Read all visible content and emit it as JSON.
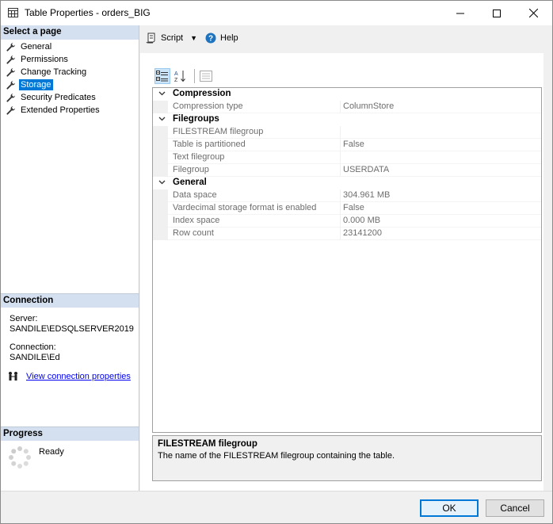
{
  "window": {
    "title": "Table Properties - orders_BIG"
  },
  "left": {
    "select_page_header": "Select a page",
    "pages": [
      {
        "label": "General",
        "selected": false
      },
      {
        "label": "Permissions",
        "selected": false
      },
      {
        "label": "Change Tracking",
        "selected": false
      },
      {
        "label": "Storage",
        "selected": true
      },
      {
        "label": "Security Predicates",
        "selected": false
      },
      {
        "label": "Extended Properties",
        "selected": false
      }
    ],
    "connection_header": "Connection",
    "server_label": "Server:",
    "server_value": "SANDILE\\EDSQLSERVER2019",
    "connection_label": "Connection:",
    "connection_value": "SANDILE\\Ed",
    "view_link": "View connection properties",
    "progress_header": "Progress",
    "progress_status": "Ready"
  },
  "toolbar": {
    "script_label": "Script",
    "help_label": "Help"
  },
  "grid": {
    "categories": [
      {
        "name": "Compression",
        "props": [
          {
            "name": "Compression type",
            "value": "ColumnStore"
          }
        ]
      },
      {
        "name": "Filegroups",
        "props": [
          {
            "name": "FILESTREAM filegroup",
            "value": ""
          },
          {
            "name": "Table is partitioned",
            "value": "False"
          },
          {
            "name": "Text filegroup",
            "value": ""
          },
          {
            "name": "Filegroup",
            "value": "USERDATA"
          }
        ]
      },
      {
        "name": "General",
        "props": [
          {
            "name": "Data space",
            "value": "304.961 MB"
          },
          {
            "name": "Vardecimal storage format is enabled",
            "value": "False"
          },
          {
            "name": "Index space",
            "value": "0.000 MB"
          },
          {
            "name": "Row count",
            "value": "23141200"
          }
        ]
      }
    ]
  },
  "description": {
    "title": "FILESTREAM filegroup",
    "text": "The name of the FILESTREAM filegroup containing the table."
  },
  "buttons": {
    "ok": "OK",
    "cancel": "Cancel"
  },
  "colors": {
    "selection": "#0078d7",
    "section_header": "#d4e0f0",
    "help_icon": "#1e73be"
  }
}
